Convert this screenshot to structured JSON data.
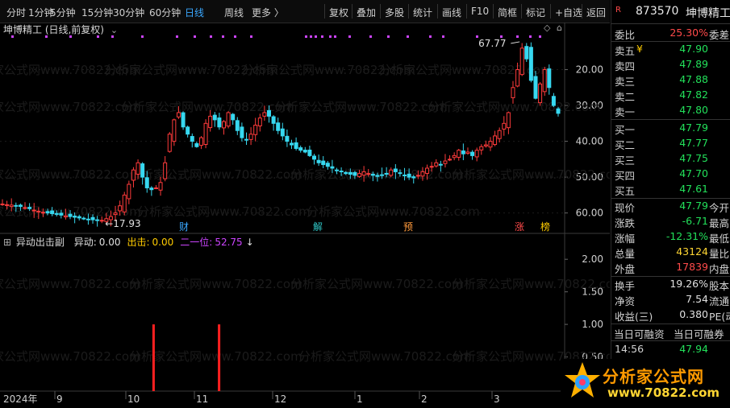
{
  "toolbar": {
    "periods": [
      "分时",
      "1分钟",
      "5分钟",
      "15分钟",
      "30分钟",
      "60分钟",
      "日线",
      "周线",
      "更多 〉"
    ],
    "active_period": "日线",
    "actions": [
      "复权",
      "叠加",
      "多股",
      "统计",
      "画线",
      "F10",
      "简框",
      "标记",
      "+自选",
      "返回"
    ]
  },
  "chart_header": {
    "title": "坤博精工 (日线,前复权)",
    "chevron": "⌄"
  },
  "watermark": "分析家公式网www.70822.com",
  "price_panel": {
    "y_ticks": [
      "60.00",
      "50.00",
      "40.00",
      "30.00",
      "20.00"
    ],
    "high_label": "67.77",
    "low_label": "17.93",
    "events": [
      {
        "text": "财",
        "color": "#3aa8ff"
      },
      {
        "text": "解",
        "color": "#2fc8c8"
      },
      {
        "text": "预",
        "color": "#ff9a3c"
      },
      {
        "text": "涨",
        "color": "#ff4a4a"
      },
      {
        "text": "榜",
        "color": "#ffcc00"
      }
    ]
  },
  "indicator_panel": {
    "title": "异动出击副",
    "items": [
      {
        "label": "异动:",
        "value": "0.00",
        "color": "#e0e0e0"
      },
      {
        "label": "出击:",
        "value": "0.00",
        "color": "#ffcc00"
      },
      {
        "label": "二一位:",
        "value": "52.75",
        "color": "#cc44ff"
      }
    ],
    "y_ticks": [
      "2.00",
      "1.50",
      "1.00",
      "0.50"
    ]
  },
  "x_axis": {
    "labels": [
      "2024年",
      "9",
      "10",
      "11",
      "12",
      "1",
      "2",
      "3"
    ]
  },
  "quote": {
    "tag": "R",
    "code": "873570",
    "name": "坤博精工",
    "weibi": {
      "label": "委比",
      "value": "25.30%",
      "extra": "委差"
    },
    "asks": [
      {
        "label": "卖五",
        "mark": "¥",
        "price": "47.90"
      },
      {
        "label": "卖四",
        "price": "47.89"
      },
      {
        "label": "卖三",
        "price": "47.88"
      },
      {
        "label": "卖二",
        "price": "47.82"
      },
      {
        "label": "卖一",
        "price": "47.80"
      }
    ],
    "bids": [
      {
        "label": "买一",
        "price": "47.79"
      },
      {
        "label": "买二",
        "price": "47.77"
      },
      {
        "label": "买三",
        "price": "47.75"
      },
      {
        "label": "买四",
        "price": "47.70"
      },
      {
        "label": "买五",
        "price": "47.61"
      }
    ],
    "stats": [
      {
        "label": "现价",
        "value": "47.79",
        "color": "#22e05a",
        "extra": "今开"
      },
      {
        "label": "涨跌",
        "value": "-6.71",
        "color": "#22e05a",
        "extra": "最高"
      },
      {
        "label": "涨幅",
        "value": "-12.31%",
        "color": "#22e05a",
        "extra": "最低"
      },
      {
        "label": "总量",
        "value": "43124",
        "color": "#ffd633",
        "extra": "量比"
      },
      {
        "label": "外盘",
        "value": "17839",
        "color": "#ff4a4a",
        "extra": "内盘"
      },
      {
        "label": "换手",
        "value": "19.26%",
        "color": "#e0e0e0",
        "extra": "股本"
      },
      {
        "label": "净资",
        "value": "7.54",
        "color": "#e0e0e0",
        "extra": "流通"
      },
      {
        "label": "收益(三)",
        "value": "0.380",
        "color": "#e0e0e0",
        "extra": "PE(动)"
      }
    ],
    "margin": {
      "left": "当日可融资",
      "right": "当日可融券"
    },
    "last_trade": {
      "time": "14:56",
      "price": "47.94"
    }
  },
  "logo": {
    "text": "分析家公式网",
    "url": "www.70822.com"
  },
  "chart_data": {
    "type": "candlestick",
    "title": "坤博精工 (日线,前复权)",
    "y_range": [
      17,
      70
    ],
    "y_ticks": [
      20,
      30,
      40,
      50,
      60
    ],
    "x_labels": [
      "2024年",
      "9",
      "10",
      "11",
      "12",
      "1",
      "2",
      "3"
    ],
    "high": 67.77,
    "low": 17.93,
    "close_series": [
      22.5,
      22.3,
      22.2,
      22.0,
      21.8,
      21.5,
      21.2,
      20.8,
      20.5,
      20.2,
      20.0,
      19.8,
      19.6,
      19.4,
      19.2,
      19.0,
      18.8,
      18.6,
      18.4,
      18.2,
      18.1,
      18.0,
      17.95,
      18.4,
      19.0,
      20.0,
      22.0,
      25.0,
      28.0,
      32.0,
      34.0,
      30.0,
      27.0,
      26.5,
      27.0,
      28.5,
      34.0,
      42.0,
      46.0,
      48.0,
      44.0,
      42.0,
      40.0,
      38.5,
      41.0,
      45.0,
      47.0,
      46.0,
      44.0,
      45.5,
      48.0,
      46.0,
      43.0,
      41.0,
      40.5,
      42.0,
      44.5,
      46.5,
      48.0,
      47.0,
      45.0,
      43.0,
      41.5,
      40.0,
      39.0,
      38.0,
      37.5,
      37.0,
      36.0,
      35.0,
      34.0,
      33.5,
      33.0,
      32.5,
      32.0,
      31.5,
      31.0,
      30.8,
      30.5,
      31.0,
      31.5,
      31.0,
      30.5,
      30.2,
      30.5,
      31.0,
      32.0,
      31.5,
      31.0,
      30.5,
      30.0,
      29.8,
      30.5,
      31.5,
      32.5,
      33.0,
      34.0,
      33.5,
      34.5,
      35.0,
      36.0,
      37.5,
      36.5,
      37.0,
      36.0,
      37.5,
      38.5,
      39.0,
      40.0,
      41.5,
      43.0,
      45.0,
      48.0,
      55.0,
      60.0,
      66.0,
      63.0,
      57.0,
      52.0,
      56.0,
      60.0,
      55.0,
      50.0,
      47.8
    ],
    "volume_signal_bars": [
      {
        "x_frac": 0.272,
        "value": 1.0
      },
      {
        "x_frac": 0.388,
        "value": 1.0
      }
    ],
    "indicator_ylim": [
      0,
      2.2
    ]
  }
}
